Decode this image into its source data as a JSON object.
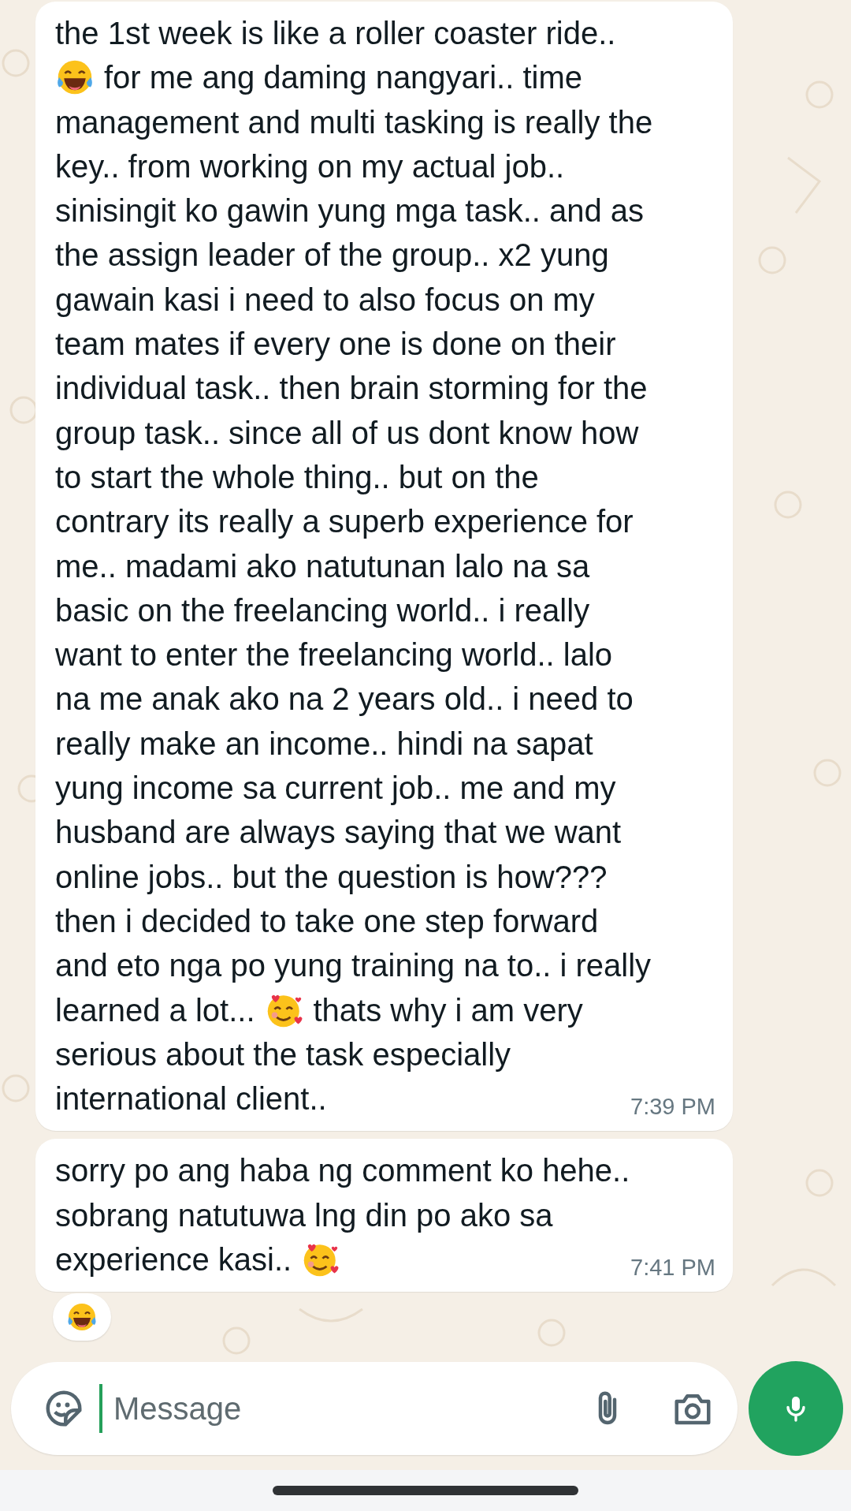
{
  "messages": [
    {
      "lines": [
        [
          {
            "kind": "text",
            "text": "the 1st week is like a roller coaster ride.."
          }
        ],
        [
          {
            "kind": "laugh-emoji"
          },
          {
            "kind": "text",
            "text": "for me ang daming nangyari.. time"
          }
        ],
        [
          {
            "kind": "text",
            "text": "management and multi tasking is really the"
          }
        ],
        [
          {
            "kind": "text",
            "text": "key.. from working on my actual job.."
          }
        ],
        [
          {
            "kind": "text",
            "text": "sinisingit ko gawin yung mga task.. and as"
          }
        ],
        [
          {
            "kind": "text",
            "text": "the assign leader of the group.. x2 yung"
          }
        ],
        [
          {
            "kind": "text",
            "text": "gawain kasi i need to also focus on my"
          }
        ],
        [
          {
            "kind": "text",
            "text": "team mates if every one is done on their"
          }
        ],
        [
          {
            "kind": "text",
            "text": "individual task.. then brain storming for the"
          }
        ],
        [
          {
            "kind": "text",
            "text": "group task.. since all of us dont know how"
          }
        ],
        [
          {
            "kind": "text",
            "text": "to start the whole thing.. but on the"
          }
        ],
        [
          {
            "kind": "text",
            "text": "contrary its really a superb experience for"
          }
        ],
        [
          {
            "kind": "text",
            "text": "me.. madami ako natutunan lalo na sa"
          }
        ],
        [
          {
            "kind": "text",
            "text": "basic on the freelancing world.. i really"
          }
        ],
        [
          {
            "kind": "text",
            "text": "want to enter the freelancing world.. lalo"
          }
        ],
        [
          {
            "kind": "text",
            "text": "na me anak ako na 2 years old.. i need to"
          }
        ],
        [
          {
            "kind": "text",
            "text": "really make an income.. hindi na sapat"
          }
        ],
        [
          {
            "kind": "text",
            "text": "yung income sa current job.. me and my"
          }
        ],
        [
          {
            "kind": "text",
            "text": "husband are always saying that we want"
          }
        ],
        [
          {
            "kind": "text",
            "text": "online jobs.. but the question is how???"
          }
        ],
        [
          {
            "kind": "text",
            "text": "then i decided to take one step forward"
          }
        ],
        [
          {
            "kind": "text",
            "text": "and eto nga po yung training na to.. i really"
          }
        ],
        [
          {
            "kind": "text",
            "text": "learned a lot..."
          },
          {
            "kind": "love-emoji"
          },
          {
            "kind": "text",
            "text": "thats why i am very"
          }
        ],
        [
          {
            "kind": "text",
            "text": "serious about the task especially"
          }
        ],
        [
          {
            "kind": "text",
            "text": "international client.."
          }
        ]
      ],
      "time": "7:39 PM"
    },
    {
      "lines": [
        [
          {
            "kind": "text",
            "text": "sorry po ang haba ng comment ko hehe.."
          }
        ],
        [
          {
            "kind": "text",
            "text": "sobrang natutuwa lng din po ako sa"
          }
        ],
        [
          {
            "kind": "text",
            "text": "experience kasi.."
          },
          {
            "kind": "love-emoji"
          }
        ]
      ],
      "time": "7:41 PM",
      "reaction": {
        "kind": "laugh-emoji"
      }
    }
  ],
  "composer": {
    "placeholder": "Message"
  }
}
